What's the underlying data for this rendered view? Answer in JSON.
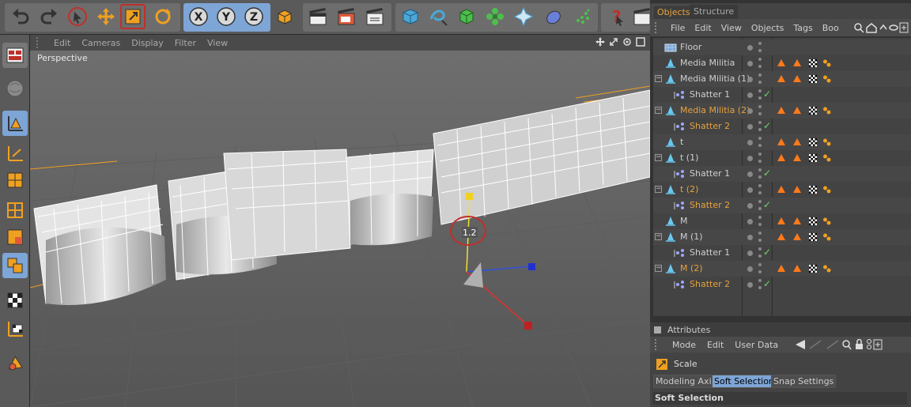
{
  "viewport": {
    "menu": [
      "Edit",
      "Cameras",
      "Display",
      "Filter",
      "View"
    ],
    "label": "Perspective",
    "gizmo_value": "1.2"
  },
  "toolbar": {
    "axis_x": "X",
    "axis_y": "Y",
    "axis_z": "Z"
  },
  "object_manager": {
    "tabs": [
      "Objects",
      "Structure"
    ],
    "menu": [
      "File",
      "Edit",
      "View",
      "Objects",
      "Tags",
      "Boo"
    ],
    "rows": [
      {
        "name": "Floor",
        "level": 0,
        "type": "floor",
        "highlight": false,
        "tags": false,
        "check": false
      },
      {
        "name": "Media Militia",
        "level": 0,
        "type": "null",
        "highlight": false,
        "tags": true,
        "check": false
      },
      {
        "name": "Media Militia (1)",
        "level": 0,
        "type": "null",
        "highlight": false,
        "tags": true,
        "check": false
      },
      {
        "name": "Shatter 1",
        "level": 1,
        "type": "shatter",
        "highlight": false,
        "tags": false,
        "check": true
      },
      {
        "name": "Media Militia (2)",
        "level": 0,
        "type": "null",
        "highlight": true,
        "tags": true,
        "check": false
      },
      {
        "name": "Shatter 2",
        "level": 1,
        "type": "shatter",
        "highlight": true,
        "tags": false,
        "check": true
      },
      {
        "name": "t",
        "level": 0,
        "type": "null",
        "highlight": false,
        "tags": true,
        "check": false
      },
      {
        "name": "t (1)",
        "level": 0,
        "type": "null",
        "highlight": false,
        "tags": true,
        "check": false
      },
      {
        "name": "Shatter 1",
        "level": 1,
        "type": "shatter",
        "highlight": false,
        "tags": false,
        "check": true
      },
      {
        "name": "t (2)",
        "level": 0,
        "type": "null",
        "highlight": true,
        "tags": true,
        "check": false
      },
      {
        "name": "Shatter 2",
        "level": 1,
        "type": "shatter",
        "highlight": true,
        "tags": false,
        "check": true
      },
      {
        "name": "M",
        "level": 0,
        "type": "null",
        "highlight": false,
        "tags": true,
        "check": false
      },
      {
        "name": "M (1)",
        "level": 0,
        "type": "null",
        "highlight": false,
        "tags": true,
        "check": false
      },
      {
        "name": "Shatter 1",
        "level": 1,
        "type": "shatter",
        "highlight": false,
        "tags": false,
        "check": true
      },
      {
        "name": "M (2)",
        "level": 0,
        "type": "null",
        "highlight": true,
        "tags": true,
        "check": false
      },
      {
        "name": "Shatter 2",
        "level": 1,
        "type": "shatter",
        "highlight": true,
        "tags": false,
        "check": true
      }
    ]
  },
  "attributes": {
    "title": "Attributes",
    "menu": [
      "Mode",
      "Edit",
      "User Data"
    ],
    "tool_name": "Scale",
    "tabs": [
      "Modeling Axis",
      "Soft Selection",
      "Snap Settings"
    ],
    "active_tab": "Soft Selection",
    "section_header": "Soft Selection"
  },
  "colors": {
    "highlight_text": "#e6a23c",
    "accent_blue": "#7da5d6",
    "tag_orange": "#ff7a1a"
  }
}
